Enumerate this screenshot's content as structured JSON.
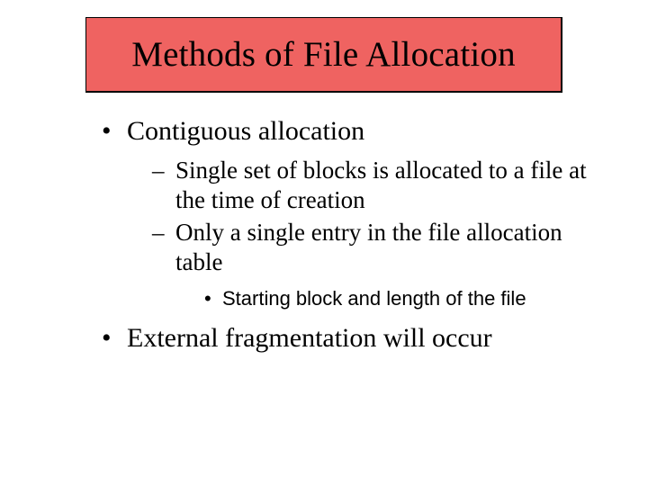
{
  "title": "Methods of File Allocation",
  "bullets": {
    "item1": "Contiguous allocation",
    "item1_sub1": "Single set of blocks is allocated to a file at the time of creation",
    "item1_sub2": "Only a single entry in the file allocation table",
    "item1_sub2_sub1": "Starting block and length of the file",
    "item2": "External fragmentation will occur"
  }
}
